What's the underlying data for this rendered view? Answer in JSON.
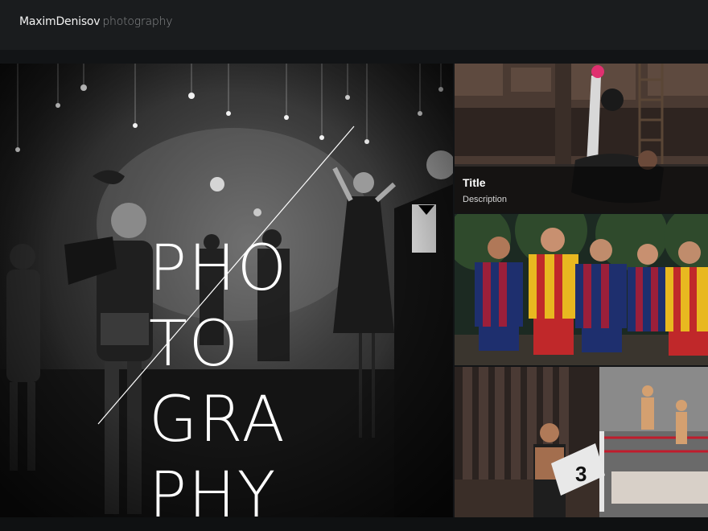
{
  "header": {
    "brand_name": "MaximDenisov",
    "brand_sub": "photography"
  },
  "hero": {
    "title_lines": [
      "PHO",
      "TO",
      "GRA",
      "PHY"
    ]
  },
  "tiles": [
    {
      "title": "Title",
      "description": "Description"
    }
  ],
  "colors": {
    "header_bg": "#1a1c1e",
    "page_bg": "#121416",
    "caption_bg": "rgba(0,0,0,0.55)"
  }
}
